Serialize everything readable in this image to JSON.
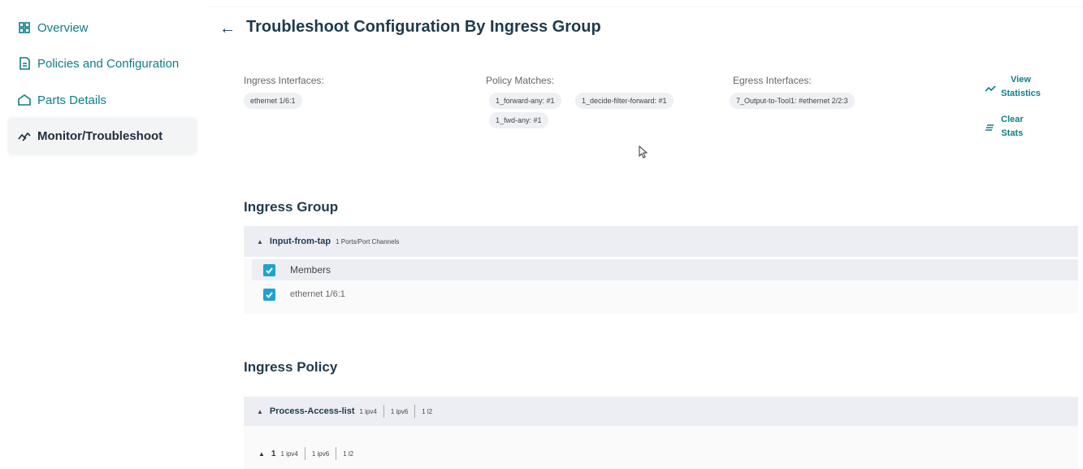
{
  "sidebar": {
    "items": [
      {
        "label": "Overview",
        "icon": "grid-icon"
      },
      {
        "label": "Policies and Configuration",
        "icon": "policy-doc-icon"
      },
      {
        "label": "Parts Details",
        "icon": "parts-icon"
      },
      {
        "label": "Monitor/Troubleshoot",
        "icon": "monitor-chart-icon",
        "active": true
      }
    ]
  },
  "header": {
    "back": "←",
    "title": "Troubleshoot Configuration By Ingress Group"
  },
  "summary": {
    "ingress_label": "Ingress Interfaces:",
    "ingress_chips": [
      "ethernet 1/6:1"
    ],
    "policy_label": "Policy Matches:",
    "policy_chips": [
      "1_forward-any: #1",
      "1_decide-filter-forward: #1",
      "1_fwd-any: #1"
    ],
    "egress_label": "Egress Interfaces:",
    "egress_chips": [
      "7_Output-to-Tool1: #ethernet 2/2:3"
    ]
  },
  "actions": {
    "view_stats_line1": "View",
    "view_stats_line2": "Statistics",
    "clear_stats_line1": "Clear",
    "clear_stats_line2": "Stats"
  },
  "ingress_group": {
    "title": "Ingress Group",
    "group_name": "Input-from-tap",
    "group_meta": "1 Ports/Port Channels",
    "members_header": "Members",
    "members": [
      "ethernet 1/6:1"
    ]
  },
  "ingress_policy": {
    "title": "Ingress Policy",
    "policy_name": "Process-Access-list",
    "counts": [
      "1 ipv4",
      "1 ipv6",
      "1 l2"
    ],
    "sub_name": "1",
    "sub_counts": [
      "1 ipv4",
      "1 ipv6",
      "1 l2"
    ]
  },
  "colors": {
    "accent": "#0f7d88",
    "heading": "#1f3a4d",
    "checkbox": "#1ea3ce",
    "row_header_bg": "#eceef4"
  }
}
